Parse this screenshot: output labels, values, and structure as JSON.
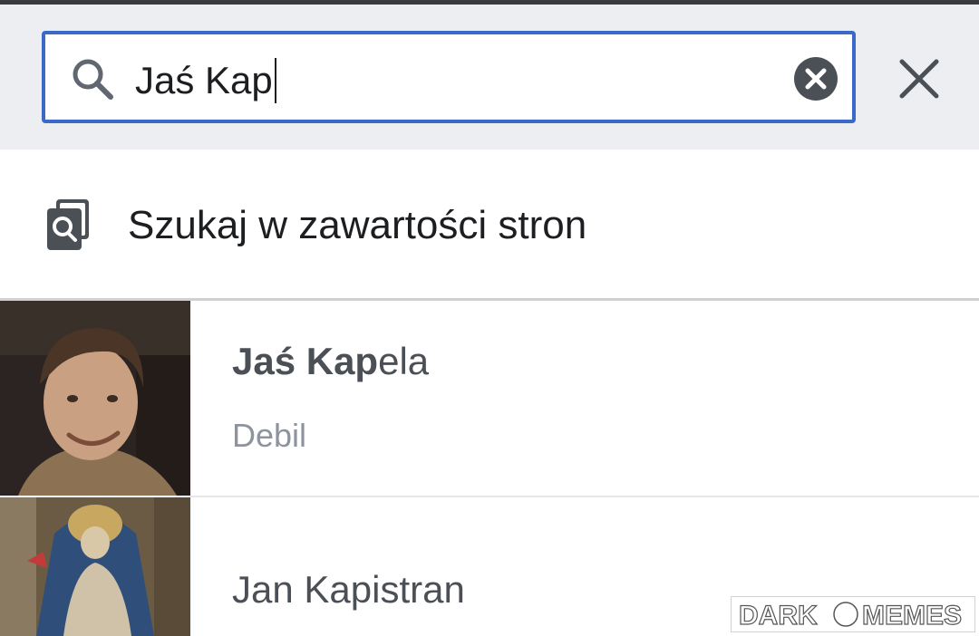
{
  "search": {
    "query": "Jaś Kap",
    "icon": "search-icon",
    "clear_icon": "clear-icon",
    "close_icon": "close-icon"
  },
  "content_search": {
    "label": "Szukaj w zawartości stron",
    "icon": "search-pages-icon"
  },
  "results": [
    {
      "name_match": "Jaś Kap",
      "name_rest": "ela",
      "subtitle": "Debil"
    },
    {
      "name": "Jan Kapistran"
    }
  ],
  "watermark": "DARK MEMES",
  "colors": {
    "search_border": "#3b69c9",
    "header_bg": "#eceef2",
    "text_primary": "#1c1e21",
    "text_secondary": "#8d949e"
  }
}
